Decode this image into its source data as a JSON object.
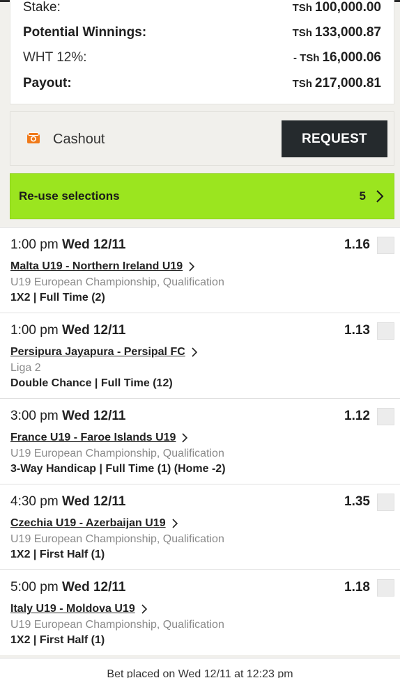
{
  "summary": {
    "stake_label": "Stake:",
    "stake_currency": "TSh",
    "stake_value": "100,000.00",
    "potential_label": "Potential Winnings:",
    "potential_currency": "TSh",
    "potential_value": "133,000.87",
    "wht_label": "WHT 12%:",
    "wht_currency": "- TSh",
    "wht_value": "16,000.06",
    "payout_label": "Payout:",
    "payout_currency": "TSh",
    "payout_value": "217,000.81"
  },
  "cashout": {
    "label": "Cashout",
    "icon": "cashout-icon",
    "button_label": "REQUEST"
  },
  "reuse": {
    "label": "Re-use selections",
    "count": "5",
    "icon": "chevron-right-icon",
    "color": "#9be51f"
  },
  "selections": [
    {
      "time": "1:00 pm",
      "date": "Wed 12/11",
      "odds": "1.16",
      "match": "Malta U19 - Northern Ireland U19",
      "competition": "U19 European Championship, Qualification",
      "market": "1X2 | Full Time (2)"
    },
    {
      "time": "1:00 pm",
      "date": "Wed 12/11",
      "odds": "1.13",
      "match": "Persipura Jayapura - Persipal FC",
      "competition": "Liga 2",
      "market": "Double Chance | Full Time (12)"
    },
    {
      "time": "3:00 pm",
      "date": "Wed 12/11",
      "odds": "1.12",
      "match": "France U19 - Faroe Islands U19",
      "competition": "U19 European Championship, Qualification",
      "market": "3-Way Handicap | Full Time (1) (Home -2)"
    },
    {
      "time": "4:30 pm",
      "date": "Wed 12/11",
      "odds": "1.35",
      "match": "Czechia U19 - Azerbaijan U19",
      "competition": "U19 European Championship, Qualification",
      "market": "1X2 | First Half (1)"
    },
    {
      "time": "5:00 pm",
      "date": "Wed 12/11",
      "odds": "1.18",
      "match": "Italy U19 - Moldova U19",
      "competition": "U19 European Championship, Qualification",
      "market": "1X2 | First Half (1)"
    }
  ],
  "footer": {
    "placed_text": "Bet placed on Wed 12/11 at 12:23 pm"
  }
}
